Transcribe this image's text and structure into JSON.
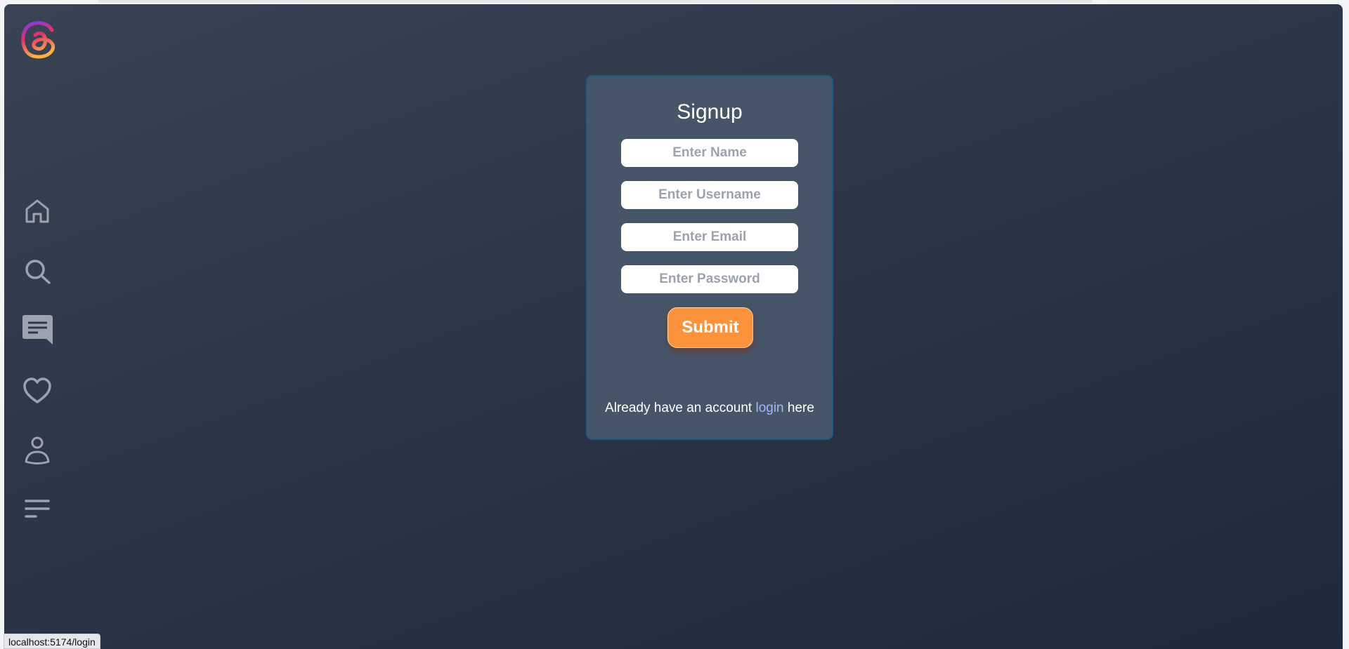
{
  "brand": {
    "logo": "threads-logo"
  },
  "sidebar": {
    "items": [
      {
        "icon": "home-icon"
      },
      {
        "icon": "search-icon"
      },
      {
        "icon": "chat-icon"
      },
      {
        "icon": "heart-icon"
      },
      {
        "icon": "user-icon"
      },
      {
        "icon": "menu-icon"
      }
    ]
  },
  "form": {
    "title": "Signup",
    "name_placeholder": "Enter Name",
    "username_placeholder": "Enter Username",
    "email_placeholder": "Enter Email",
    "password_placeholder": "Enter Password",
    "submit_label": "Submit",
    "footer_prefix": "Already have an account ",
    "footer_link": "login",
    "footer_suffix": " here"
  },
  "status_bar": {
    "url": "localhost:5174/login"
  },
  "colors": {
    "accent": "#fb923c",
    "link": "#a5b4fc",
    "card": "#475569"
  }
}
